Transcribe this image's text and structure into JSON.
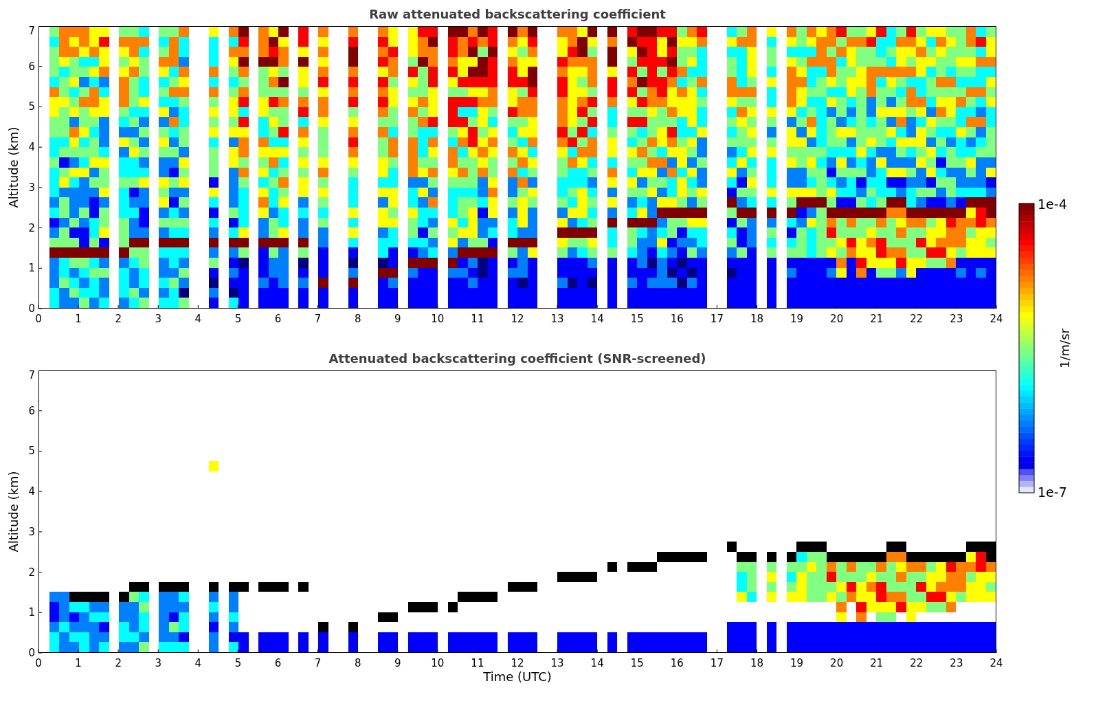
{
  "panels": [
    {
      "kind": "raw",
      "title": "Raw attenuated backscattering coefficient",
      "ylabel": "Altitude (km)",
      "yticks": [
        "7",
        "6",
        "5",
        "4",
        "3",
        "2",
        "1",
        "0"
      ],
      "xticks": [
        "0",
        "1",
        "2",
        "3",
        "4",
        "5",
        "6",
        "7",
        "8",
        "9",
        "10",
        "11",
        "12",
        "13",
        "14",
        "15",
        "16",
        "17",
        "18",
        "19",
        "20",
        "21",
        "22",
        "23",
        "24"
      ]
    },
    {
      "kind": "screened",
      "title": "Attenuated backscattering coefficient (SNR-screened)",
      "ylabel": "Altitude (km)",
      "yticks": [
        "7",
        "6",
        "5",
        "4",
        "3",
        "2",
        "1",
        "0"
      ],
      "xticks": [
        "0",
        "1",
        "2",
        "3",
        "4",
        "5",
        "6",
        "7",
        "8",
        "9",
        "10",
        "11",
        "12",
        "13",
        "14",
        "15",
        "16",
        "17",
        "18",
        "19",
        "20",
        "21",
        "22",
        "23",
        "24"
      ],
      "xlabel": "Time (UTC)"
    }
  ],
  "colorbar": {
    "label": "1/m/sr",
    "max_label": "1e-4",
    "min_label": "1e-7"
  }
}
